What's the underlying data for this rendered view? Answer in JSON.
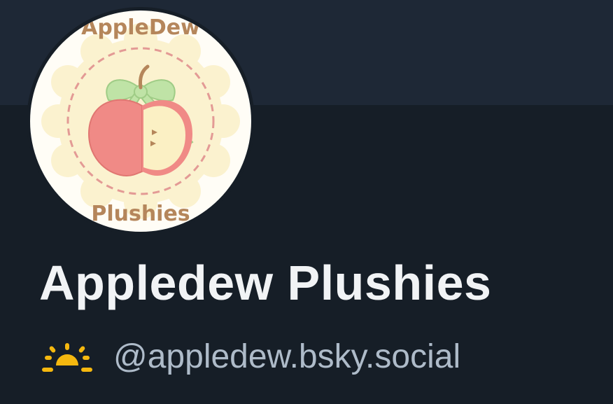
{
  "profile": {
    "display_name": "Appledew Plushies",
    "handle": "@appledew.bsky.social",
    "handle_icon": "sun-icon",
    "avatar": {
      "logo_text_top": "AppleDew",
      "logo_text_bottom": "Plushies"
    }
  },
  "colors": {
    "banner": "#1e2836",
    "background": "#161e27",
    "display_name": "#f1f3f5",
    "handle": "#aebbc9",
    "sun_icon": "#f5b80f",
    "logo_text": "#b5865b",
    "apple_red": "#f08a86",
    "apple_cream": "#fbf0c4",
    "bow_green": "#bfe3a6"
  }
}
